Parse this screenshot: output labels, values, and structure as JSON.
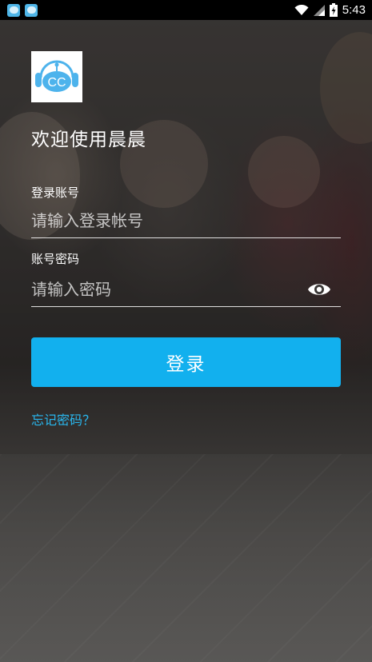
{
  "status_bar": {
    "time": "5:43",
    "icons": [
      "app-notification-icon",
      "app-notification-icon",
      "wifi-icon",
      "signal-icon",
      "battery-charging-icon"
    ]
  },
  "welcome_text": "欢迎使用晨晨",
  "logo": {
    "text": "CC",
    "icon": "headphones-cloud-logo",
    "color": "#4db3ec"
  },
  "account": {
    "label": "登录账号",
    "placeholder": "请输入登录帐号",
    "value": ""
  },
  "password": {
    "label": "账号密码",
    "placeholder": "请输入密码",
    "value": "",
    "toggle_icon": "eye-icon"
  },
  "login_button": {
    "label": "登录",
    "color": "#12b0ee"
  },
  "forgot_password": {
    "label": "忘记密码？",
    "color": "#29b8f0"
  }
}
